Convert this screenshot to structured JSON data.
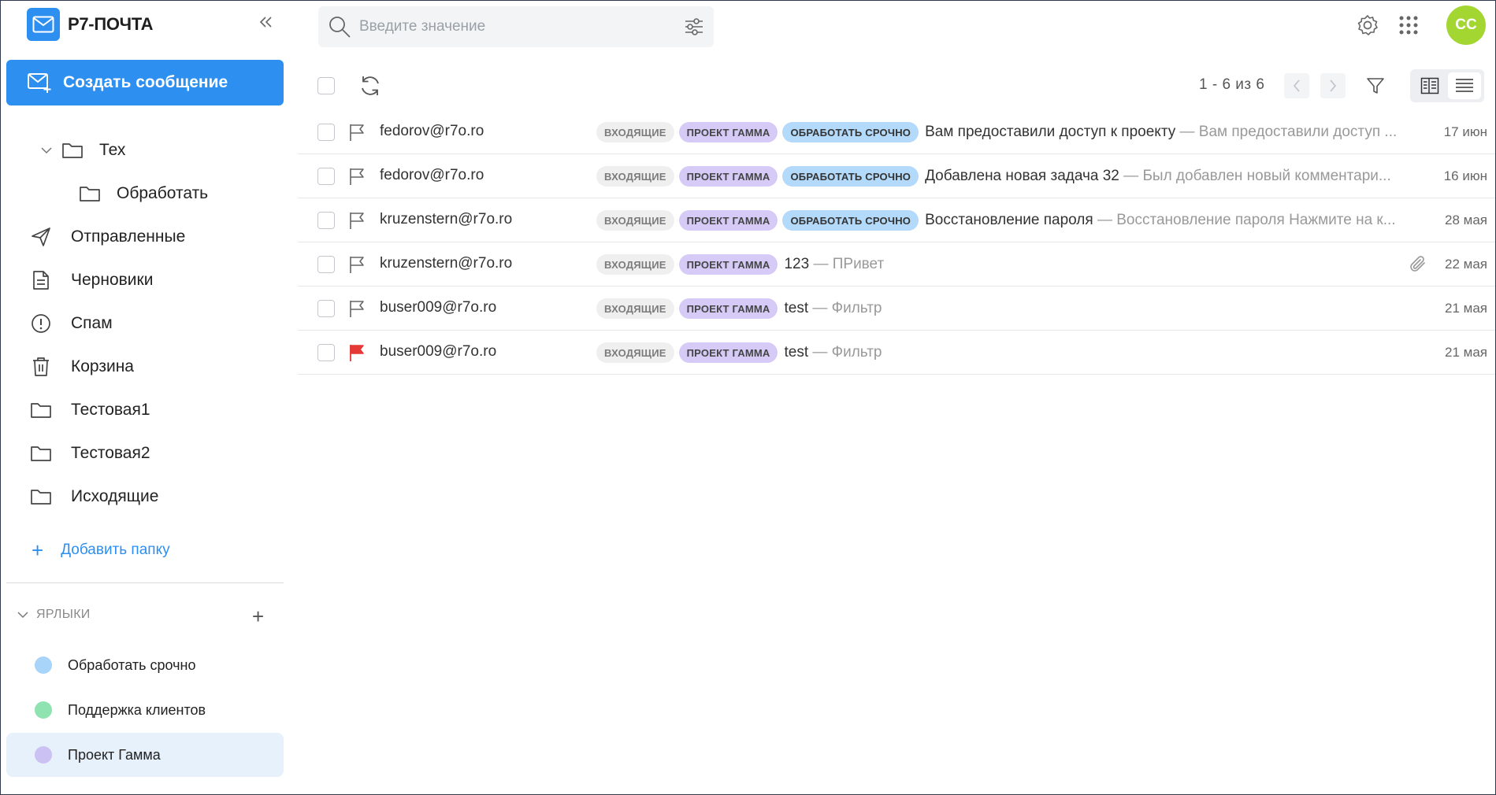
{
  "app": {
    "name": "Р7-ПОЧТА"
  },
  "compose": {
    "label": "Создать сообщение"
  },
  "folders": [
    {
      "label": "Тех"
    },
    {
      "label": "Обработать"
    },
    {
      "label": "Отправленные"
    },
    {
      "label": "Черновики"
    },
    {
      "label": "Спам"
    },
    {
      "label": "Корзина"
    },
    {
      "label": "Тестовая1"
    },
    {
      "label": "Тестовая2"
    },
    {
      "label": "Исходящие"
    }
  ],
  "add_folder": {
    "label": "Добавить папку"
  },
  "labels_section": {
    "title": "ЯРЛЫКИ"
  },
  "labels": [
    {
      "label": "Обработать срочно",
      "color": "#a8d4fa"
    },
    {
      "label": "Поддержка клиентов",
      "color": "#8fe3b0"
    },
    {
      "label": "Проект Гамма",
      "color": "#cbc1f3"
    }
  ],
  "search": {
    "placeholder": "Введите значение"
  },
  "user": {
    "initials": "СС",
    "avatar_color": "#a3d630"
  },
  "pager": {
    "text": "1 - 6 из 6"
  },
  "messages": [
    {
      "from": "fedorov@r7o.ro",
      "tags": [
        "ВХОДЯЩИЕ",
        "ПРОЕКТ ГАММА",
        "ОБРАБОТАТЬ СРОЧНО"
      ],
      "subject": "Вам предоставили доступ к проекту",
      "preview": "Вам предоставили доступ ...",
      "date": "17 июн",
      "flagged": false,
      "attachment": false
    },
    {
      "from": "fedorov@r7o.ro",
      "tags": [
        "ВХОДЯЩИЕ",
        "ПРОЕКТ ГАММА",
        "ОБРАБОТАТЬ СРОЧНО"
      ],
      "subject": "Добавлена новая задача 32",
      "preview": "Был добавлен новый комментари...",
      "date": "16 июн",
      "flagged": false,
      "attachment": false
    },
    {
      "from": "kruzenstern@r7o.ro",
      "tags": [
        "ВХОДЯЩИЕ",
        "ПРОЕКТ ГАММА",
        "ОБРАБОТАТЬ СРОЧНО"
      ],
      "subject": "Восстановление пароля",
      "preview": "Восстановление пароля Нажмите на к...",
      "date": "28 мая",
      "flagged": false,
      "attachment": false
    },
    {
      "from": "kruzenstern@r7o.ro",
      "tags": [
        "ВХОДЯЩИЕ",
        "ПРОЕКТ ГАММА"
      ],
      "subject": "123",
      "preview": "ПРивет",
      "date": "22 мая",
      "flagged": false,
      "attachment": true
    },
    {
      "from": "buser009@r7o.ro",
      "tags": [
        "ВХОДЯЩИЕ",
        "ПРОЕКТ ГАММА"
      ],
      "subject": "test",
      "preview": "Фильтр",
      "date": "21 мая",
      "flagged": false,
      "attachment": false
    },
    {
      "from": "buser009@r7o.ro",
      "tags": [
        "ВХОДЯЩИЕ",
        "ПРОЕКТ ГАММА"
      ],
      "subject": "test",
      "preview": "Фильтр",
      "date": "21 мая",
      "flagged": true,
      "attachment": false
    }
  ],
  "separator": "—",
  "colors": {
    "accent": "#2d8ff0",
    "flag_active": "#e53935"
  }
}
